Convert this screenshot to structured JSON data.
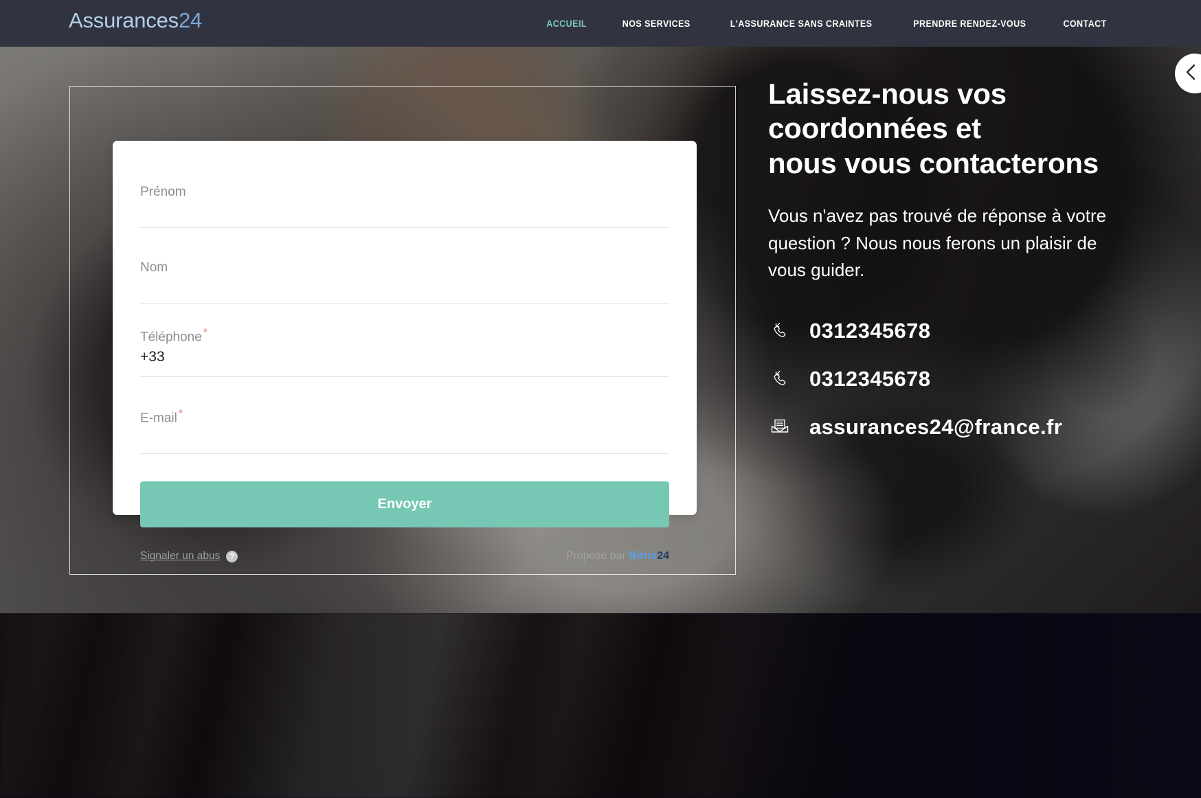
{
  "header": {
    "logo_main": "Assurances",
    "logo_num": "24",
    "nav": [
      {
        "label": "ACCUEIL",
        "active": true
      },
      {
        "label": "NOS SERVICES",
        "active": false
      },
      {
        "label": "L'ASSURANCE SANS CRAINTES",
        "active": false
      },
      {
        "label": "PRENDRE RENDEZ-VOUS",
        "active": false
      },
      {
        "label": "CONTACT",
        "active": false
      }
    ]
  },
  "slider": {
    "prev_icon": "chevron-left-icon"
  },
  "form": {
    "fields": [
      {
        "label": "Prénom",
        "required": false,
        "value": ""
      },
      {
        "label": "Nom",
        "required": false,
        "value": ""
      },
      {
        "label": "Téléphone",
        "required": true,
        "value": "+33"
      },
      {
        "label": "E-mail",
        "required": true,
        "value": ""
      }
    ],
    "required_mark": "*",
    "submit_label": "Envoyer",
    "abuse_label": "Signaler un abus",
    "help_icon_glyph": "?",
    "powered_prefix": "Proposé par",
    "powered_brand": "Bitrix",
    "powered_brand_num": "24"
  },
  "promo": {
    "title": "Laissez-nous vos coordonnées et nous vous contacterons",
    "title_line1": "Laissez-nous vos",
    "title_line2": "coordonnées et",
    "title_line3": "nous vous contacterons",
    "paragraph": "Vous n'avez pas trouvé de réponse à votre question ? Nous nous ferons un plaisir de vous guider.",
    "contacts": [
      {
        "icon": "phone-incoming-icon",
        "text": "0312345678"
      },
      {
        "icon": "phone-incoming-icon",
        "text": "0312345678"
      },
      {
        "icon": "envelope-icon",
        "text": "assurances24@france.fr"
      }
    ]
  },
  "colors": {
    "navbar": "#313340",
    "accent_mint": "#76c7b4",
    "nav_active": "#7fc8bd",
    "logo_main": "#b4cfe8",
    "logo_num": "#7ba7d6",
    "required_star": "#e2796d",
    "bitrix_blue": "#5b9fe8",
    "bitrix_navy": "#1d3f6e"
  }
}
